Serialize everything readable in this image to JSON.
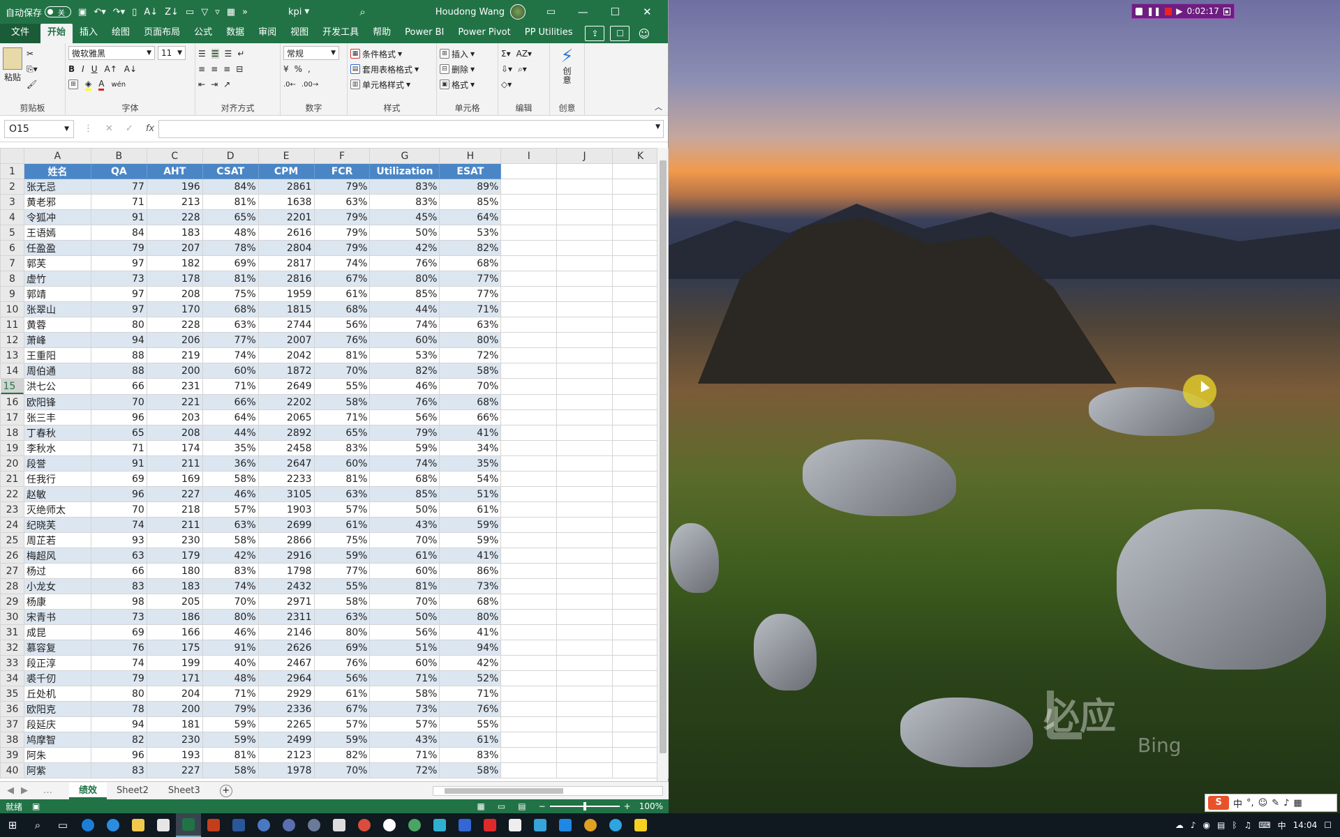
{
  "window": {
    "autosave_label": "自动保存",
    "autosave_state": "关",
    "doc_title": "kpi",
    "user_name": "Houdong Wang",
    "minimize": "—",
    "maximize": "☐",
    "close": "✕",
    "overflow": "»"
  },
  "tabs": [
    {
      "label": "文件"
    },
    {
      "label": "开始"
    },
    {
      "label": "插入"
    },
    {
      "label": "绘图"
    },
    {
      "label": "页面布局"
    },
    {
      "label": "公式"
    },
    {
      "label": "数据"
    },
    {
      "label": "审阅"
    },
    {
      "label": "视图"
    },
    {
      "label": "开发工具"
    },
    {
      "label": "帮助"
    },
    {
      "label": "Power BI"
    },
    {
      "label": "Power Pivot"
    },
    {
      "label": "PP Utilities"
    }
  ],
  "ribbon": {
    "clipboard": {
      "label": "剪贴板",
      "paste": "粘贴"
    },
    "font": {
      "label": "字体",
      "font_name": "微软雅黑",
      "font_size": "11"
    },
    "alignment": {
      "label": "对齐方式"
    },
    "number": {
      "label": "数字",
      "format": "常规"
    },
    "styles": {
      "label": "样式",
      "conditional": "条件格式",
      "table": "套用表格格式",
      "cell": "单元格样式"
    },
    "cells": {
      "label": "单元格",
      "insert": "插入",
      "delete": "删除",
      "format": "格式"
    },
    "editing": {
      "label": "编辑"
    },
    "creative": {
      "label": "创意",
      "button": "创意"
    }
  },
  "formula": {
    "name_box": "O15",
    "fx": "fx",
    "value": ""
  },
  "columns": [
    "A",
    "B",
    "C",
    "D",
    "E",
    "F",
    "G",
    "H",
    "I",
    "J",
    "K"
  ],
  "headers": [
    "姓名",
    "QA",
    "AHT",
    "CSAT",
    "CPM",
    "FCR",
    "Utilization",
    "ESAT"
  ],
  "rows": [
    [
      "张无忌",
      "77",
      "196",
      "84%",
      "2861",
      "79%",
      "83%",
      "89%"
    ],
    [
      "黄老邪",
      "71",
      "213",
      "81%",
      "1638",
      "63%",
      "83%",
      "85%"
    ],
    [
      "令狐冲",
      "91",
      "228",
      "65%",
      "2201",
      "79%",
      "45%",
      "64%"
    ],
    [
      "王语嫣",
      "84",
      "183",
      "48%",
      "2616",
      "79%",
      "50%",
      "53%"
    ],
    [
      "任盈盈",
      "79",
      "207",
      "78%",
      "2804",
      "79%",
      "42%",
      "82%"
    ],
    [
      "郭芙",
      "97",
      "182",
      "69%",
      "2817",
      "74%",
      "76%",
      "68%"
    ],
    [
      "虚竹",
      "73",
      "178",
      "81%",
      "2816",
      "67%",
      "80%",
      "77%"
    ],
    [
      "郭靖",
      "97",
      "208",
      "75%",
      "1959",
      "61%",
      "85%",
      "77%"
    ],
    [
      "张翠山",
      "97",
      "170",
      "68%",
      "1815",
      "68%",
      "44%",
      "71%"
    ],
    [
      "黄蓉",
      "80",
      "228",
      "63%",
      "2744",
      "56%",
      "74%",
      "63%"
    ],
    [
      "萧峰",
      "94",
      "206",
      "77%",
      "2007",
      "76%",
      "60%",
      "80%"
    ],
    [
      "王重阳",
      "88",
      "219",
      "74%",
      "2042",
      "81%",
      "53%",
      "72%"
    ],
    [
      "周伯通",
      "88",
      "200",
      "60%",
      "1872",
      "70%",
      "82%",
      "58%"
    ],
    [
      "洪七公",
      "66",
      "231",
      "71%",
      "2649",
      "55%",
      "46%",
      "70%"
    ],
    [
      "欧阳锋",
      "70",
      "221",
      "66%",
      "2202",
      "58%",
      "76%",
      "68%"
    ],
    [
      "张三丰",
      "96",
      "203",
      "64%",
      "2065",
      "71%",
      "56%",
      "66%"
    ],
    [
      "丁春秋",
      "65",
      "208",
      "44%",
      "2892",
      "65%",
      "79%",
      "41%"
    ],
    [
      "李秋水",
      "71",
      "174",
      "35%",
      "2458",
      "83%",
      "59%",
      "34%"
    ],
    [
      "段誉",
      "91",
      "211",
      "36%",
      "2647",
      "60%",
      "74%",
      "35%"
    ],
    [
      "任我行",
      "69",
      "169",
      "58%",
      "2233",
      "81%",
      "68%",
      "54%"
    ],
    [
      "赵敏",
      "96",
      "227",
      "46%",
      "3105",
      "63%",
      "85%",
      "51%"
    ],
    [
      "灭绝师太",
      "70",
      "218",
      "57%",
      "1903",
      "57%",
      "50%",
      "61%"
    ],
    [
      "纪晓芙",
      "74",
      "211",
      "63%",
      "2699",
      "61%",
      "43%",
      "59%"
    ],
    [
      "周芷若",
      "93",
      "230",
      "58%",
      "2866",
      "75%",
      "70%",
      "59%"
    ],
    [
      "梅超风",
      "63",
      "179",
      "42%",
      "2916",
      "59%",
      "61%",
      "41%"
    ],
    [
      "杨过",
      "66",
      "180",
      "83%",
      "1798",
      "77%",
      "60%",
      "86%"
    ],
    [
      "小龙女",
      "83",
      "183",
      "74%",
      "2432",
      "55%",
      "81%",
      "73%"
    ],
    [
      "杨康",
      "98",
      "205",
      "70%",
      "2971",
      "58%",
      "70%",
      "68%"
    ],
    [
      "宋青书",
      "73",
      "186",
      "80%",
      "2311",
      "63%",
      "50%",
      "80%"
    ],
    [
      "成昆",
      "69",
      "166",
      "46%",
      "2146",
      "80%",
      "56%",
      "41%"
    ],
    [
      "慕容复",
      "76",
      "175",
      "91%",
      "2626",
      "69%",
      "51%",
      "94%"
    ],
    [
      "段正淳",
      "74",
      "199",
      "40%",
      "2467",
      "76%",
      "60%",
      "42%"
    ],
    [
      "裘千仞",
      "79",
      "171",
      "48%",
      "2964",
      "56%",
      "71%",
      "52%"
    ],
    [
      "丘处机",
      "80",
      "204",
      "71%",
      "2929",
      "61%",
      "58%",
      "71%"
    ],
    [
      "欧阳克",
      "78",
      "200",
      "79%",
      "2336",
      "67%",
      "73%",
      "76%"
    ],
    [
      "段延庆",
      "94",
      "181",
      "59%",
      "2265",
      "57%",
      "57%",
      "55%"
    ],
    [
      "鸠摩智",
      "82",
      "230",
      "59%",
      "2499",
      "59%",
      "43%",
      "61%"
    ],
    [
      "阿朱",
      "96",
      "193",
      "81%",
      "2123",
      "82%",
      "71%",
      "83%"
    ],
    [
      "阿紫",
      "83",
      "227",
      "58%",
      "1978",
      "70%",
      "72%",
      "58%"
    ]
  ],
  "sheets": [
    {
      "label": "绩效"
    },
    {
      "label": "Sheet2"
    },
    {
      "label": "Sheet3"
    }
  ],
  "status": {
    "ready": "就绪",
    "zoom": "100%"
  },
  "recorder": {
    "time": "0:02:17"
  },
  "desktop": {
    "watermark": "必应",
    "watermark_en": "Bing"
  },
  "taskbar": {
    "time": "14:04",
    "ime_lang": "中"
  },
  "colors": {
    "excel_green": "#217346",
    "header_blue": "#4a86c6",
    "band_blue": "#dce6f1"
  }
}
